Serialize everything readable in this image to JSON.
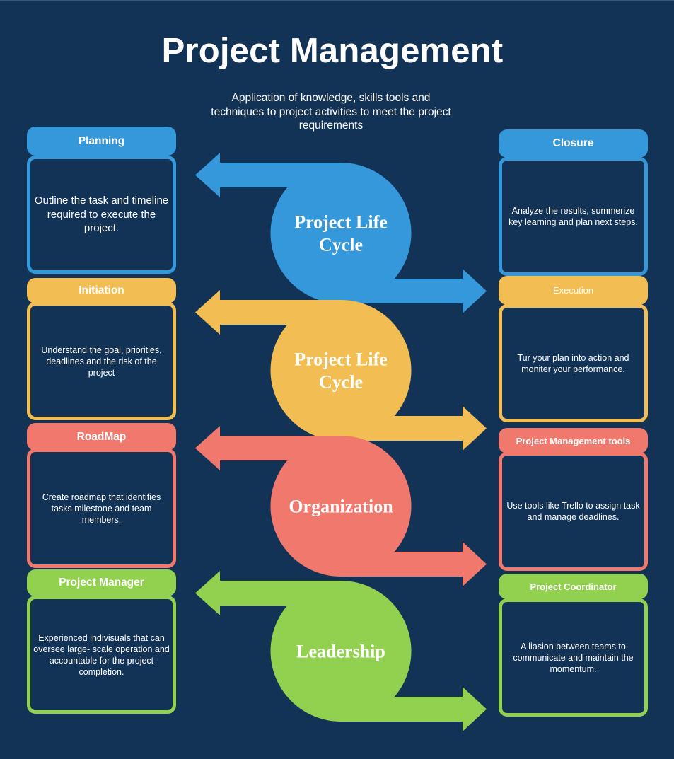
{
  "title": "Project Management",
  "subtitle": "Application of knowledge, skills tools and techniques to project activities to meet the project requirements",
  "colors": {
    "background": "#133356",
    "blue": "#3598DB",
    "yellow": "#F2BE54",
    "red": "#F1786C",
    "green": "#92D050",
    "text": "#FFFFFF"
  },
  "center_shapes": [
    {
      "label_lines": [
        "Project Life",
        "Cycle"
      ],
      "color": "#3598DB"
    },
    {
      "label_lines": [
        "Project Life",
        "Cycle"
      ],
      "color": "#F2BE54"
    },
    {
      "label_lines": [
        "Organization"
      ],
      "color": "#F1786C"
    },
    {
      "label_lines": [
        "Leadership"
      ],
      "color": "#92D050"
    }
  ],
  "left_cards": [
    {
      "title": "Planning",
      "text": "Outline the task and timeline required to execute the project.",
      "color": "#3598DB"
    },
    {
      "title": "Initiation",
      "text": "Understand the goal, priorities, deadlines and the risk of the project",
      "color": "#F2BE54"
    },
    {
      "title": "RoadMap",
      "text": "Create roadmap that identifies tasks milestone and team members.",
      "color": "#F1786C"
    },
    {
      "title": "Project Manager",
      "text": "Experienced indivisuals that can oversee large- scale operation and accountable for the project completion.",
      "color": "#92D050"
    }
  ],
  "right_cards": [
    {
      "title": "Closure",
      "text": "Analyze the results, summerize key learning and plan next steps.",
      "color": "#3598DB"
    },
    {
      "title": "Execution",
      "text": "Tur your plan into action and moniter your performance.",
      "color": "#F2BE54"
    },
    {
      "title": "Project Management tools",
      "text": "Use tools like Trello to assign task and manage deadlines.",
      "color": "#F1786C"
    },
    {
      "title": "Project Coordinator",
      "text": "A liasion between teams to communicate and maintain the momentum.",
      "color": "#92D050"
    }
  ]
}
